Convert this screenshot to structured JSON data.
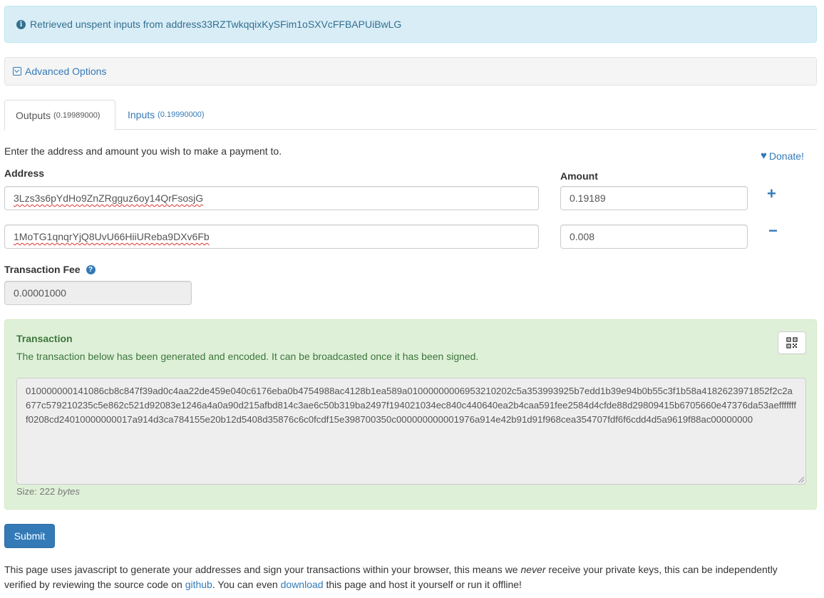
{
  "alert": {
    "prefix": "Retrieved unspent inputs from address ",
    "address": "33RZTwkqqixKySFim1oSXVcFFBAPUiBwLG"
  },
  "advanced": {
    "label": "Advanced Options"
  },
  "tabs": [
    {
      "label": "Outputs",
      "amount": "(0.19989000)",
      "active": true
    },
    {
      "label": "Inputs",
      "amount": "(0.19990000)",
      "active": false
    }
  ],
  "form": {
    "instruction": "Enter the address and amount you wish to make a payment to.",
    "donate_label": "Donate!",
    "address_label": "Address",
    "amount_label": "Amount",
    "rows": [
      {
        "address": "3Lzs3s6pYdHo9ZnZRgguz6oy14QrFsosjG",
        "amount": "0.19189",
        "action": "+"
      },
      {
        "address": "1MoTG1qnqrYjQ8UvU66HiiUReba9DXv6Fb",
        "amount": "0.008",
        "action": "−"
      }
    ],
    "fee_label": "Transaction Fee",
    "fee_value": "0.00001000"
  },
  "transaction": {
    "title": "Transaction",
    "description": "The transaction below has been generated and encoded. It can be broadcasted once it has been signed.",
    "hex": "010000000141086cb8c847f39ad0c4aa22de459e040c6176eba0b4754988ac4128b1ea589a01000000006953210202c5a353993925b7edd1b39e94b0b55c3f1b58a4182623971852f2c2a677c579210235c5e862c521d92083e1246a4a0a90d215afbd814c3ae6c50b319ba2497f194021034ec840c440640ea2b4caa591fee2584d4cfde88d29809415b6705660e47376da53aeffffffff0208cd24010000000017a914d3ca784155e20b12d5408d35876c6c0fcdf15e398700350c000000000001976a914e42b91d91f968cea354707fdf6f6cdd4d5a9619f88ac00000000",
    "size_label": "Size: ",
    "size_value": "222",
    "size_unit": "bytes"
  },
  "submit_label": "Submit",
  "footer": {
    "part1": "This page uses javascript to generate your addresses and sign your transactions within your browser, this means we ",
    "never": "never",
    "part2": " receive your private keys, this can be independently verified by reviewing the source code on ",
    "github": "github",
    "part3": ". You can even ",
    "download": "download",
    "part4": " this page and host it yourself or run it offline!"
  },
  "colors": {
    "primary": "#337ab7",
    "info_bg": "#d9edf7",
    "success_bg": "#dff0d8",
    "success_text": "#3c763d"
  }
}
